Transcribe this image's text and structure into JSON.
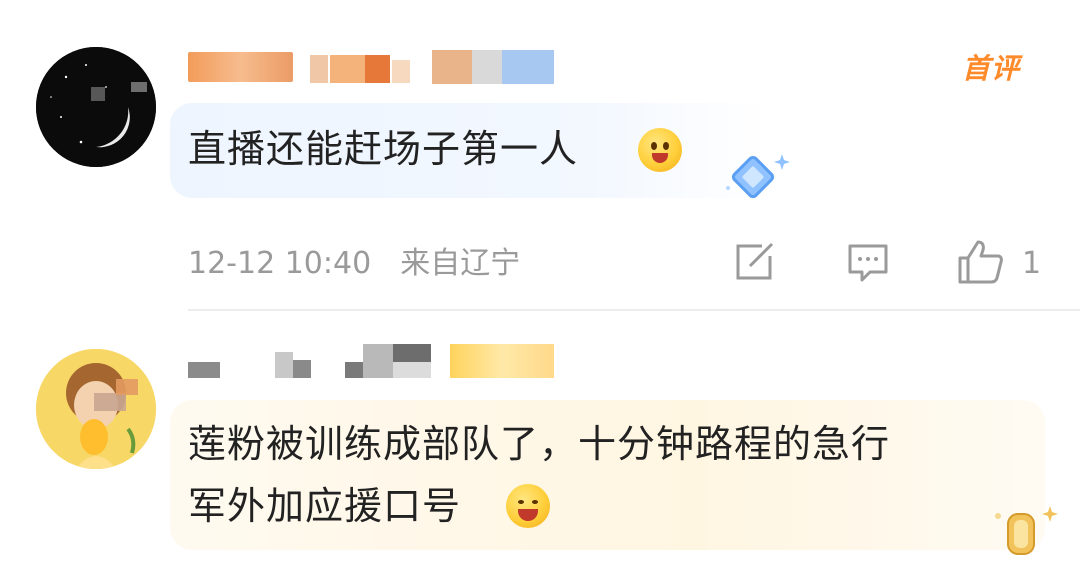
{
  "comments": [
    {
      "badge": "首评",
      "text": "直播还能赶场子第一人",
      "timestamp": "12-12 10:40",
      "location": "来自辽宁",
      "like_count": "1",
      "emoji": "hugging-face-icon"
    },
    {
      "lines": [
        "莲粉被训练成部队了，十分钟路程的急行",
        "军外加应援口号"
      ],
      "emoji": "laughing-cheering-face-icon"
    }
  ],
  "icons": {
    "share": "share-edit-icon",
    "reply": "comment-icon",
    "like": "thumbs-up-icon"
  },
  "colors": {
    "badge": "#ff8a2a",
    "meta_text": "#9a9a9a",
    "bubble1": "#eef5ff",
    "bubble2": "#fff6e2"
  }
}
